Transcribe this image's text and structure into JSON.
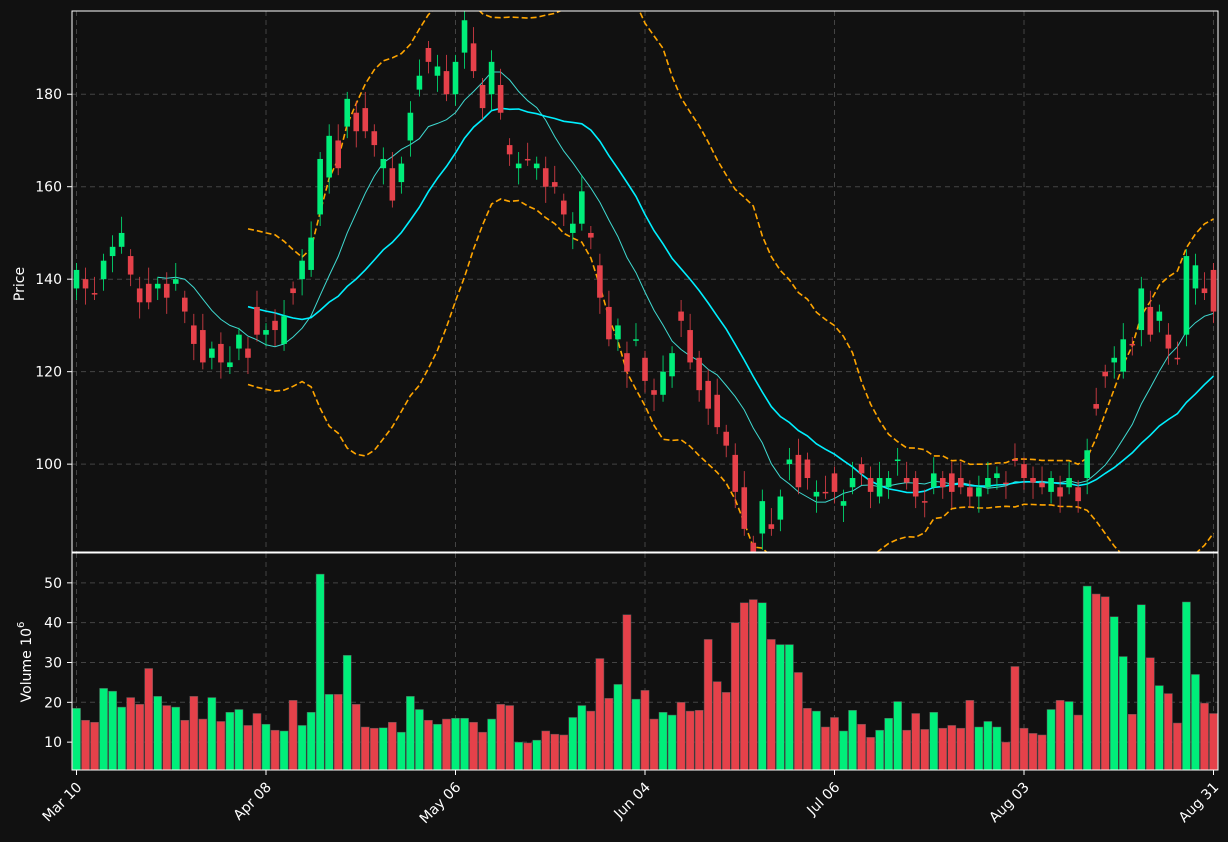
{
  "chart_data": [
    {
      "type": "candlestick",
      "panel": "price",
      "ylabel": "Price",
      "ylim": [
        81,
        198
      ],
      "yticks": [
        100,
        120,
        140,
        160,
        180
      ],
      "grid": true,
      "start_index": 0,
      "ohlc_note": "",
      "candles": [
        [
          142,
          138,
          1
        ],
        [
          140,
          138,
          0
        ],
        [
          137,
          137,
          0
        ],
        [
          140,
          144,
          1
        ],
        [
          145,
          147,
          1
        ],
        [
          147,
          150,
          1
        ],
        [
          145,
          141,
          0
        ],
        [
          138,
          135,
          0
        ],
        [
          139,
          135,
          0
        ],
        [
          138,
          139,
          1
        ],
        [
          139,
          136,
          0
        ],
        [
          139,
          140,
          1
        ],
        [
          136,
          133,
          0
        ],
        [
          130,
          126,
          0
        ],
        [
          129,
          122,
          0
        ],
        [
          123,
          125,
          1
        ],
        [
          126,
          122,
          0
        ],
        [
          121,
          122,
          1
        ],
        [
          125,
          128,
          1
        ],
        [
          125,
          123,
          0
        ],
        [
          134,
          128,
          0
        ],
        [
          128,
          129,
          1
        ],
        [
          131,
          129,
          0
        ],
        [
          126,
          132,
          1
        ],
        [
          138,
          137,
          0
        ],
        [
          140,
          144,
          1
        ],
        [
          142,
          149,
          1
        ],
        [
          154,
          166,
          1
        ],
        [
          162,
          171,
          1
        ],
        [
          170,
          164,
          0
        ],
        [
          173,
          179,
          1
        ],
        [
          176,
          172,
          0
        ],
        [
          177,
          172,
          0
        ],
        [
          172,
          169,
          0
        ],
        [
          164,
          166,
          1
        ],
        [
          164,
          157,
          0
        ],
        [
          161,
          165,
          1
        ],
        [
          170,
          176,
          1
        ],
        [
          181,
          184,
          1
        ],
        [
          187,
          190,
          0
        ],
        [
          184,
          186,
          1
        ],
        [
          185,
          180,
          0
        ],
        [
          180,
          187,
          1
        ],
        [
          189,
          196,
          1
        ],
        [
          191,
          185,
          0
        ],
        [
          182,
          177,
          0
        ],
        [
          180,
          187,
          1
        ],
        [
          182,
          176,
          0
        ],
        [
          169,
          167,
          0
        ],
        [
          164,
          165,
          1
        ],
        [
          166,
          166,
          0
        ],
        [
          164,
          165,
          1
        ],
        [
          164,
          160,
          0
        ],
        [
          161,
          160,
          0
        ],
        [
          157,
          154,
          0
        ],
        [
          150,
          152,
          1
        ],
        [
          152,
          159,
          1
        ],
        [
          150,
          149,
          0
        ],
        [
          143,
          136,
          0
        ],
        [
          134,
          127,
          0
        ],
        [
          127,
          130,
          1
        ],
        [
          124,
          120,
          0
        ],
        [
          127,
          127,
          1
        ],
        [
          123,
          118,
          0
        ],
        [
          116,
          115,
          0
        ],
        [
          115,
          120,
          1
        ],
        [
          119,
          124,
          1
        ],
        [
          133,
          131,
          0
        ],
        [
          129,
          122,
          0
        ],
        [
          123,
          116,
          0
        ],
        [
          118,
          112,
          0
        ],
        [
          115,
          108,
          0
        ],
        [
          107,
          104,
          0
        ],
        [
          102,
          94,
          0
        ],
        [
          95,
          86,
          0
        ],
        [
          83,
          81,
          0
        ],
        [
          85,
          92,
          1
        ],
        [
          87,
          86,
          0
        ],
        [
          88,
          93,
          1
        ],
        [
          100,
          101,
          1
        ],
        [
          102,
          95,
          0
        ],
        [
          101,
          97,
          0
        ],
        [
          94,
          93,
          1
        ],
        [
          94,
          94,
          0
        ],
        [
          98,
          94,
          0
        ],
        [
          91,
          92,
          1
        ],
        [
          95,
          97,
          1
        ],
        [
          100,
          98,
          0
        ],
        [
          97,
          94,
          0
        ],
        [
          93,
          97,
          1
        ],
        [
          95,
          97,
          1
        ],
        [
          101,
          101,
          1
        ],
        [
          97,
          96,
          0
        ],
        [
          97,
          93,
          0
        ],
        [
          92,
          92,
          0
        ],
        [
          95,
          98,
          1
        ],
        [
          97,
          95,
          0
        ],
        [
          98,
          94,
          0
        ],
        [
          95,
          97,
          0
        ],
        [
          95,
          93,
          0
        ],
        [
          95,
          93,
          1
        ],
        [
          95,
          97,
          1
        ],
        [
          97,
          98,
          1
        ],
        [
          96,
          96,
          0
        ],
        [
          101,
          101,
          0
        ],
        [
          100,
          97,
          0
        ],
        [
          97,
          96,
          0
        ],
        [
          96,
          95,
          0
        ],
        [
          97,
          94,
          1
        ],
        [
          95,
          93,
          0
        ],
        [
          95,
          97,
          1
        ],
        [
          95,
          92,
          0
        ],
        [
          97,
          103,
          1
        ],
        [
          113,
          112,
          0
        ],
        [
          120,
          119,
          0
        ],
        [
          122,
          123,
          1
        ],
        [
          120,
          127,
          1
        ],
        [
          126,
          126,
          0
        ],
        [
          129,
          138,
          1
        ],
        [
          134,
          128,
          0
        ],
        [
          131,
          133,
          1
        ],
        [
          128,
          125,
          0
        ],
        [
          123,
          123,
          0
        ],
        [
          128,
          145,
          1
        ],
        [
          143,
          138,
          1
        ],
        [
          138,
          137,
          0
        ],
        [
          142,
          133,
          0
        ]
      ],
      "ma_fast_label": "",
      "ma_slow_label": "",
      "bollinger_label": "",
      "colors": {
        "up": "#00ee7a",
        "down": "#e5414a",
        "ma_fast": "#3fd9d0",
        "ma_slow": "#00f0ff",
        "bands": "#ffa500",
        "grid": "#444444",
        "background": "#111111"
      }
    },
    {
      "type": "bar",
      "panel": "volume",
      "ylabel": "Volume  10",
      "ylabel_sup": "6",
      "ylim": [
        3,
        57.5
      ],
      "yticks": [
        10,
        20,
        30,
        40,
        50
      ],
      "values": [
        18.5,
        15.5,
        15,
        23.5,
        22.8,
        18.8,
        21.2,
        19.5,
        28.5,
        21.5,
        19.2,
        18.8,
        15.5,
        21.5,
        15.8,
        21.2,
        15.2,
        17.5,
        18.2,
        14.2,
        17.2,
        14.5,
        13,
        12.8,
        20.5,
        14.2,
        17.5,
        52.2,
        22,
        22,
        31.8,
        19.5,
        13.8,
        13.5,
        13.6,
        15,
        12.5,
        21.5,
        18.2,
        15.5,
        14.5,
        15.8,
        16,
        16,
        15,
        12.5,
        15.8,
        19.5,
        19.2,
        10,
        9.8,
        10.5,
        12.8,
        12,
        11.8,
        16.2,
        19.2,
        17.8,
        31,
        21,
        24.5,
        42,
        20.8,
        23,
        15.8,
        17.5,
        16.8,
        20,
        17.8,
        18,
        35.8,
        25.2,
        22.5,
        40,
        45,
        45.8,
        45,
        35.8,
        34.5,
        34.5,
        27.5,
        18.5,
        17.8,
        13.8,
        16.2,
        12.8,
        18,
        14.5,
        11.2,
        13,
        16,
        20.2,
        13,
        17.2,
        13.2,
        17.5,
        13.5,
        14.2,
        13.5,
        20.5,
        13.8,
        15.2,
        13.8,
        10,
        29,
        13.5,
        12.2,
        11.8,
        18.2,
        20.5,
        20.2,
        16.8,
        49.2,
        47.2,
        46.5,
        41.5,
        31.5,
        17,
        44.5,
        31.2,
        24.2,
        22.2,
        14.8,
        45.2,
        27,
        19.8,
        17.2
      ],
      "xtick_labels": [
        "Mar 10",
        "Apr 08",
        "May 06",
        "Jun 04",
        "Jul 06",
        "Aug 03",
        "Aug 31"
      ]
    }
  ]
}
